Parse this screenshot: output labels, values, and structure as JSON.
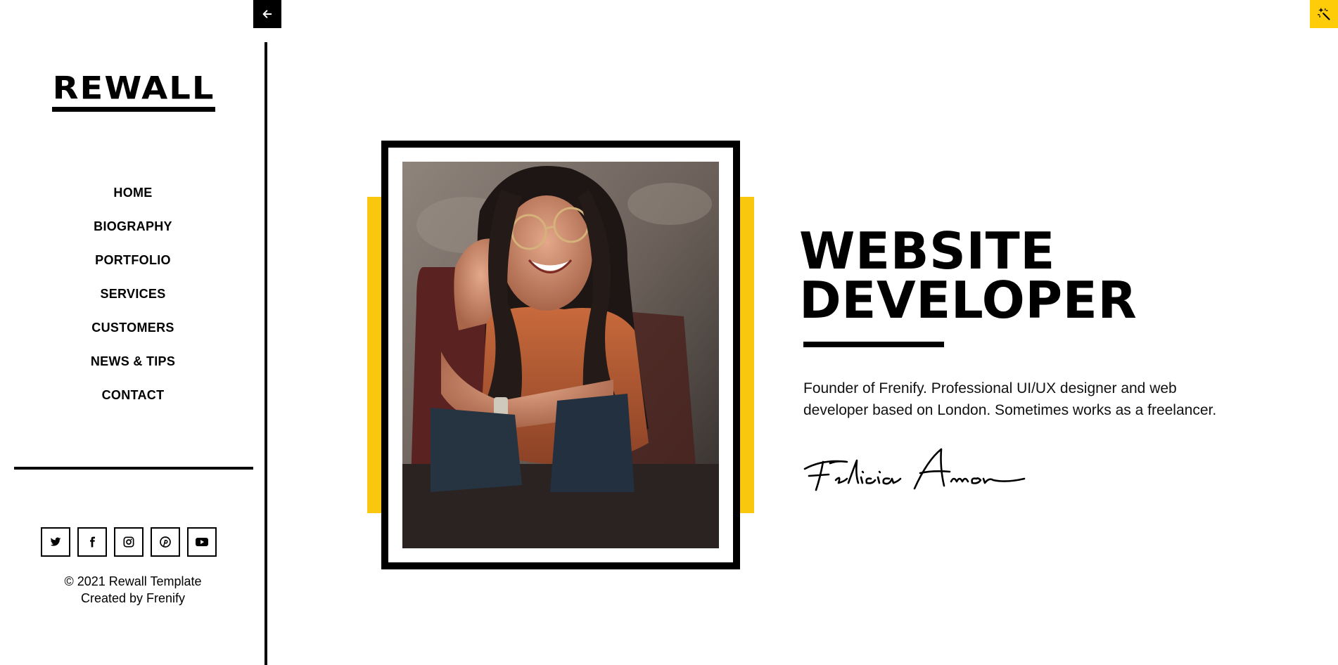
{
  "sidebar": {
    "logo": "REWALL",
    "nav": [
      {
        "label": "HOME"
      },
      {
        "label": "BIOGRAPHY"
      },
      {
        "label": "PORTFOLIO"
      },
      {
        "label": "SERVICES"
      },
      {
        "label": "CUSTOMERS"
      },
      {
        "label": "NEWS & TIPS"
      },
      {
        "label": "CONTACT"
      }
    ],
    "socials": [
      "twitter-icon",
      "facebook-icon",
      "instagram-icon",
      "pinterest-icon",
      "youtube-icon"
    ],
    "copyright_line1": "© 2021 Rewall Template",
    "copyright_line2": "Created by Frenify"
  },
  "hero": {
    "title_line1": "WEBSITE",
    "title_line2": "DEVELOPER",
    "description": "Founder of Frenify. Professional UI/UX designer and web developer based on London. Sometimes works as a freelancer.",
    "signature": "Felicia Amor"
  },
  "colors": {
    "accent": "#f9c80e",
    "text": "#000000",
    "background": "#ffffff"
  }
}
